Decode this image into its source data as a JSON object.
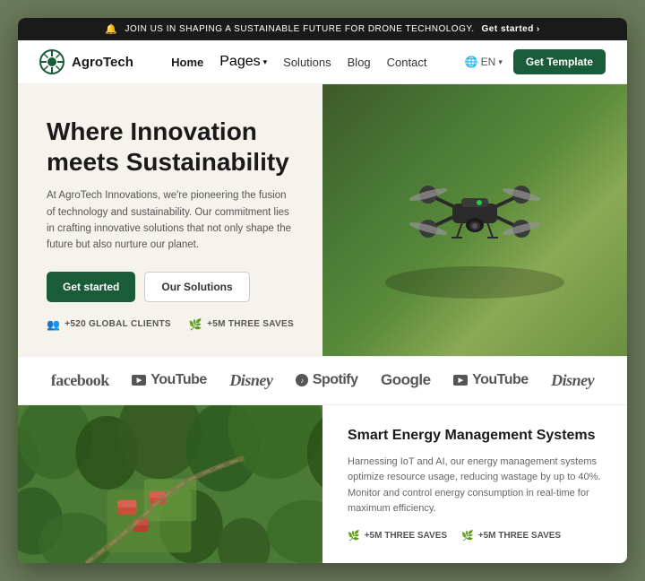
{
  "announcement": {
    "text": "JOIN US IN SHAPING A SUSTAINABLE FUTURE FOR DRONE TECHNOLOGY.",
    "cta": "Get started",
    "bell": "🔔"
  },
  "navbar": {
    "logo_text": "AgroTech",
    "links": [
      {
        "label": "Home",
        "active": true
      },
      {
        "label": "Pages",
        "dropdown": true
      },
      {
        "label": "Solutions"
      },
      {
        "label": "Blog"
      },
      {
        "label": "Contact"
      }
    ],
    "lang": "EN",
    "cta": "Get Template"
  },
  "hero": {
    "title_bold": "Where Innovation",
    "title_normal": "meets Sustainability",
    "description": "At AgroTech Innovations, we're pioneering the fusion of technology and sustainability. Our commitment lies in crafting innovative solutions that not only shape the future but also nurture our planet.",
    "btn_primary": "Get started",
    "btn_secondary": "Our Solutions",
    "stat1": "+520 GLOBAL CLIENTS",
    "stat2": "+5M THREE SAVES"
  },
  "brands": [
    {
      "name": "facebook",
      "label": "facebook",
      "type": "text"
    },
    {
      "name": "youtube1",
      "label": "YouTube",
      "type": "youtube"
    },
    {
      "name": "disney1",
      "label": "Disney",
      "type": "disney"
    },
    {
      "name": "spotify",
      "label": "Spotify",
      "type": "spotify"
    },
    {
      "name": "google",
      "label": "Google",
      "type": "text"
    },
    {
      "name": "youtube2",
      "label": "YouTube",
      "type": "youtube"
    },
    {
      "name": "disney2",
      "label": "Disney",
      "type": "disney"
    }
  ],
  "bottom": {
    "title": "Smart Energy Management Systems",
    "description": "Harnessing IoT and AI, our energy management systems optimize resource usage, reducing wastage by up to 40%. Monitor and control energy consumption in real-time for maximum efficiency.",
    "stat1": "+5M THREE SAVES",
    "stat2": "+5M THREE SAVES"
  }
}
